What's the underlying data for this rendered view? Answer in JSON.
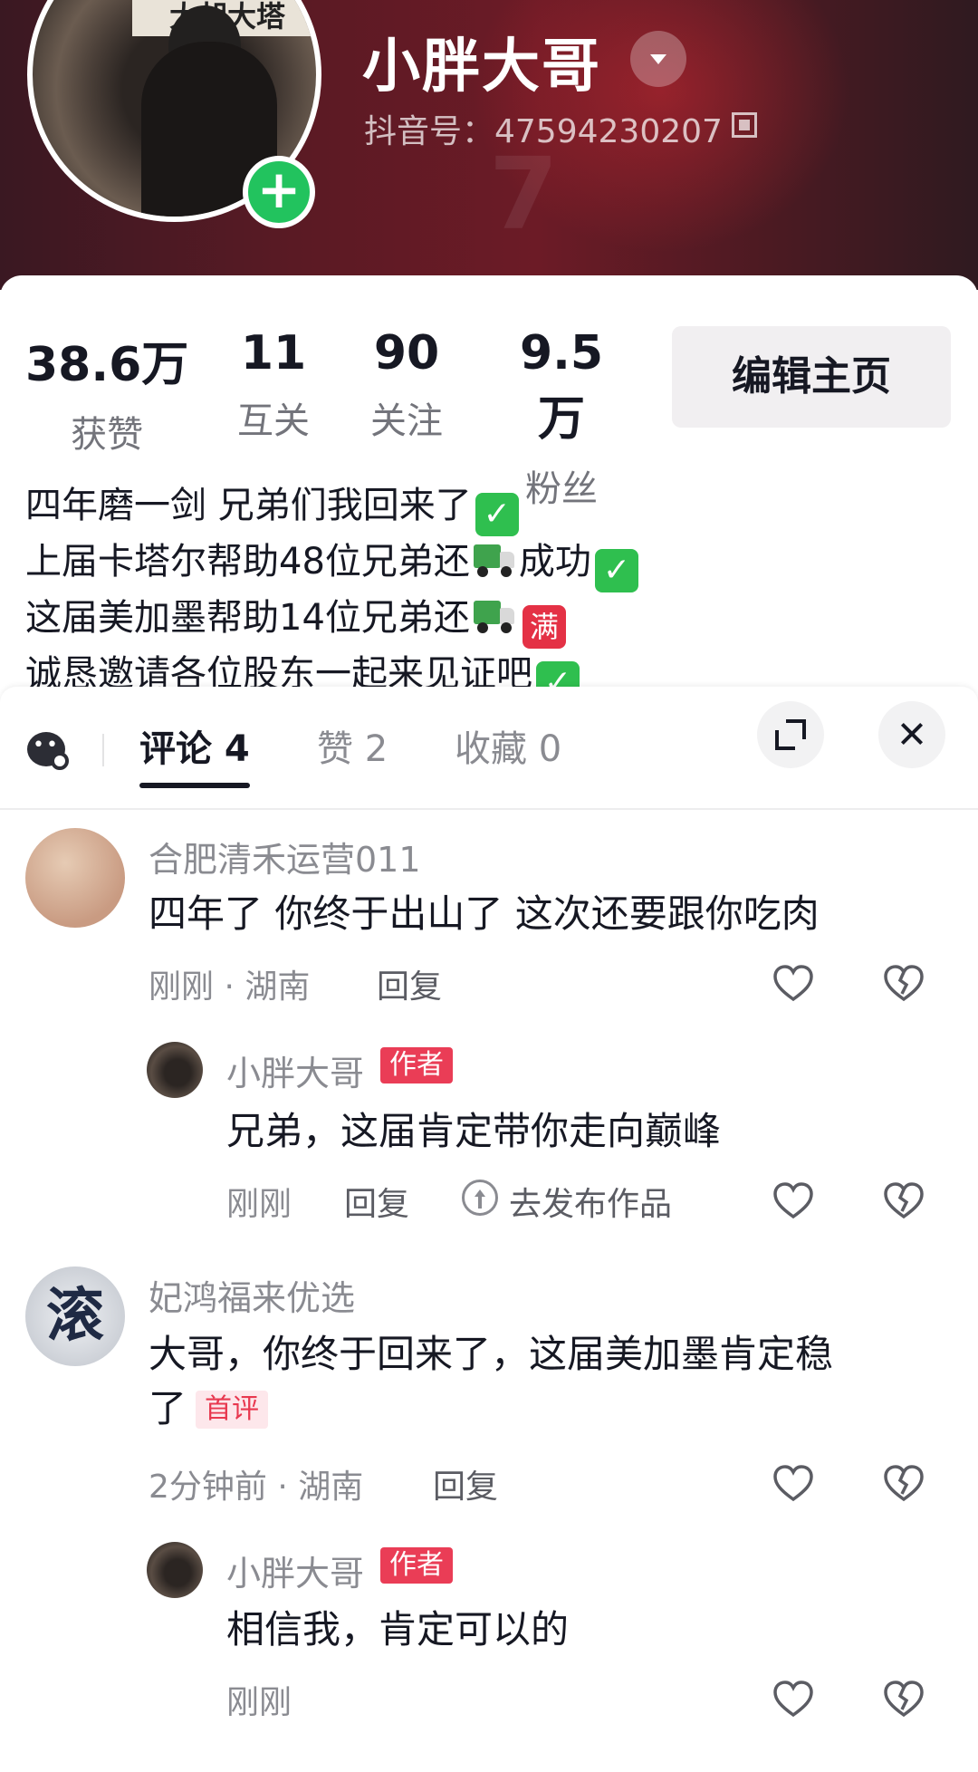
{
  "profile": {
    "name": "小胖大哥",
    "douyin_id": "抖音号：47594230207",
    "avatar_sign_text": "大胡大塔"
  },
  "stats": [
    {
      "value": "38.6万",
      "label": "获赞"
    },
    {
      "value": "11",
      "label": "互关"
    },
    {
      "value": "90",
      "label": "关注"
    },
    {
      "value": "9.5万",
      "label": "粉丝"
    }
  ],
  "edit_button": "编辑主页",
  "bio": {
    "line1": "四年磨一剑 兄弟们我回来了",
    "line2a": "上届卡塔尔帮助48位兄弟还",
    "line2b": "成功",
    "line3": "这届美加墨帮助14位兄弟还",
    "line3_badge": "满",
    "line4": "诚恳邀请各位股东一起来见证吧",
    "check_glyph": "✓"
  },
  "tabs": [
    {
      "label": "评论 4"
    },
    {
      "label": "赞 2"
    },
    {
      "label": "收藏 0"
    }
  ],
  "comments": [
    {
      "user": "合肥清禾运营011",
      "text": "四年了 你终于出山了 这次还要跟你吃肉",
      "time": "刚刚 · 湖南",
      "reply": "回复"
    },
    {
      "user": "小胖大哥",
      "tag": "作者",
      "text": "兄弟，这届肯定带你走向巅峰",
      "time": "刚刚",
      "reply": "回复",
      "publish": "去发布作品"
    },
    {
      "user": "妃鸿福来优选",
      "avatar_char": "滚",
      "text": "大哥，你终于回来了，这届美加墨肯定稳",
      "text2": "了",
      "tag": "首评",
      "time": "2分钟前 · 湖南",
      "reply": "回复"
    },
    {
      "user": "小胖大哥",
      "tag": "作者",
      "text": "相信我，肯定可以的",
      "time": "刚刚"
    }
  ],
  "colors": {
    "accent_red": "#ea3d56",
    "follow_green": "#22c35e"
  }
}
